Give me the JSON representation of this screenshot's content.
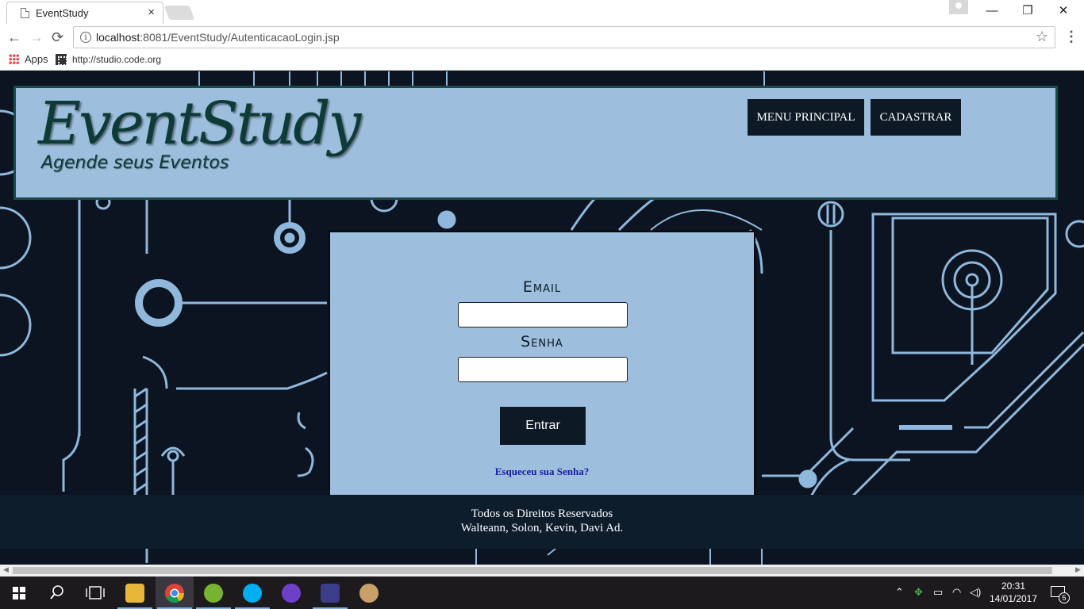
{
  "browser": {
    "tab_title": "EventStudy",
    "tab_close": "×",
    "url_host": "localhost",
    "url_rest": ":8081/EventStudy/AutenticacaoLogin.jsp",
    "bookmarks": {
      "apps_label": "Apps",
      "link_label": "http://studio.code.org"
    },
    "window_controls": {
      "minimize": "—",
      "restore": "❐",
      "close": "✕"
    },
    "nav": {
      "back": "←",
      "forward": "→",
      "reload": "⟳",
      "star": "☆",
      "menu": "⋮",
      "info": "i"
    }
  },
  "header": {
    "logo_title": "EventStudy",
    "logo_subtitle": "Agende seus Eventos",
    "nav_menu_label": "MENU PRINCIPAL",
    "nav_register_label": "CADASTRAR"
  },
  "login": {
    "email_label": "Email",
    "password_label": "Senha",
    "submit_label": "Entrar",
    "forgot_label": "Esqueceu sua Senha?"
  },
  "footer": {
    "line1": "Todos os Direitos Reservados",
    "line2": "Walteann, Solon, Kevin, Davi Ad."
  },
  "taskbar": {
    "time": "20:31",
    "date": "14/01/2017",
    "notifications": "5",
    "apps": [
      "start-icon",
      "search-icon",
      "task-view-icon",
      "file-explorer-icon",
      "chrome-icon",
      "utorrent-icon",
      "skype-icon",
      "github-icon",
      "game-icon",
      "paint-icon"
    ]
  },
  "colors": {
    "header_bg": "#9dbedc",
    "page_bg": "#0b1420",
    "button_bg": "#0d1a26",
    "logo": "#0e3a37",
    "link": "#1a1aa8"
  }
}
